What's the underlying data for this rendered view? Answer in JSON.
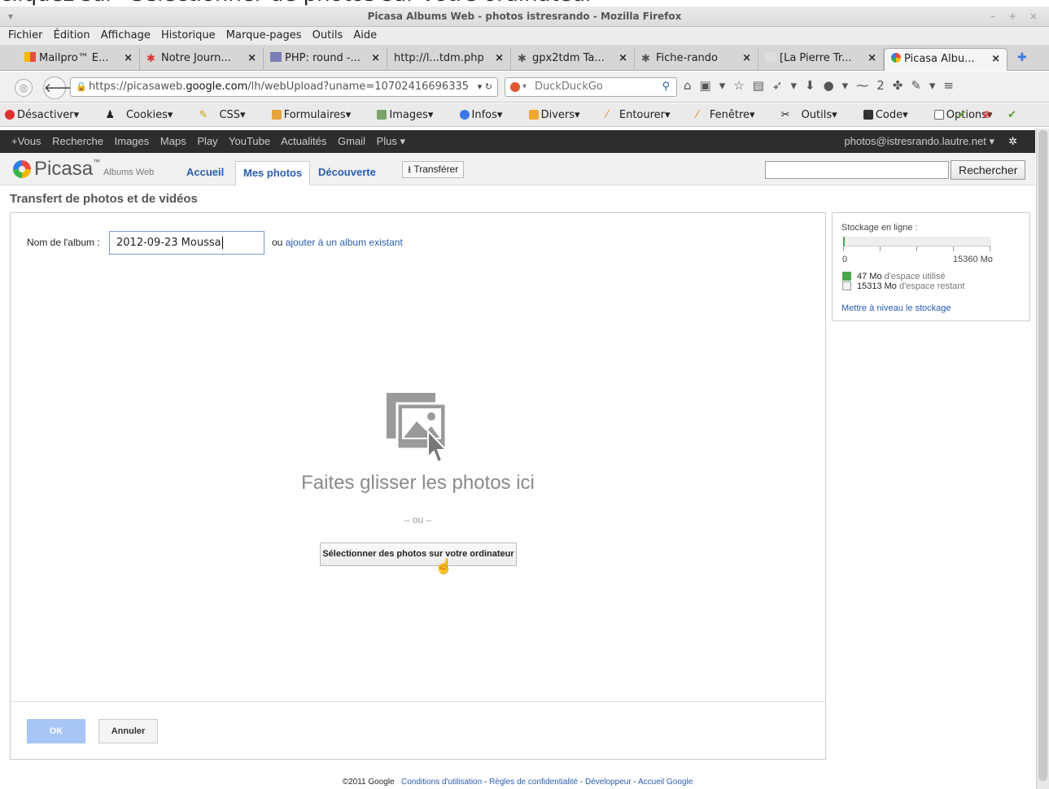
{
  "caption": "cliquez sur \"Sélectionner de photos sur votre ordinateur\"",
  "window": {
    "title": "Picasa Albums Web - photos istresrando - Mozilla Firefox",
    "controls": "– + ×"
  },
  "menu": [
    "Fichier",
    "Édition",
    "Affichage",
    "Historique",
    "Marque-pages",
    "Outils",
    "Aide"
  ],
  "tabs": [
    "Mailpro™ E...",
    "Notre Journ...",
    "PHP: round -...",
    "http://l...tdm.php",
    "gpx2tdm Ta...",
    "Fiche-rando",
    "[La Pierre Tr...",
    "Picasa Albu..."
  ],
  "tab_close": "×",
  "tab_new": "✚",
  "nav": {
    "url_prefix": "https://picasaweb.",
    "url_domain": "google.com",
    "url_suffix": "/lh/webUpload?uname=10702416696335",
    "search_placeholder": "DuckDuckGo",
    "counter": "2"
  },
  "devtoolbar": [
    "Désactiver▾",
    "Cookies▾",
    "CSS▾",
    "Formulaires▾",
    "Images▾",
    "Infos▾",
    "Divers▾",
    "Entourer▾",
    "Fenêtre▾",
    "Outils▾",
    "Code▾",
    "Options▾"
  ],
  "gbar": {
    "links": [
      "+Vous",
      "Recherche",
      "Images",
      "Maps",
      "Play",
      "YouTube",
      "Actualités",
      "Gmail",
      "Plus ▾"
    ],
    "account": "photos@istresrando.lautre.net ▾"
  },
  "picasa": {
    "logo": "Picasa",
    "logo_sub": "Albums Web",
    "tabs": [
      "Accueil",
      "Mes photos",
      "Découverte"
    ],
    "upload_button": "Transférer",
    "search_button": "Rechercher"
  },
  "page_title": "Transfert de photos et de vidéos",
  "form": {
    "album_label": "Nom de l'album :",
    "album_value": "2012-09-23 Moussa",
    "or_text": "ou",
    "existing_link": "ajouter à un album existant",
    "drop_text": "Faites glisser les photos ici",
    "or_divider": "– ou –",
    "select_button": "Sélectionner des photos sur votre ordinateur",
    "ok_button": "OK",
    "cancel_button": "Annuler"
  },
  "storage": {
    "label": "Stockage en ligne :",
    "min": "0",
    "max": "15360 Mo",
    "used_value": "47 Mo",
    "used_text": "d'espace utilisé",
    "free_value": "15313 Mo",
    "free_text": "d'espace restant",
    "upgrade_link": "Mettre à niveau le stockage",
    "used_fraction": 0.003,
    "used_color": "#4ca64c"
  },
  "footer": {
    "copyright": "©2011 Google",
    "links": [
      "Conditions d'utilisation",
      "Règles de confidentialité",
      "Développeur",
      "Accueil Google"
    ],
    "separator": " - "
  }
}
